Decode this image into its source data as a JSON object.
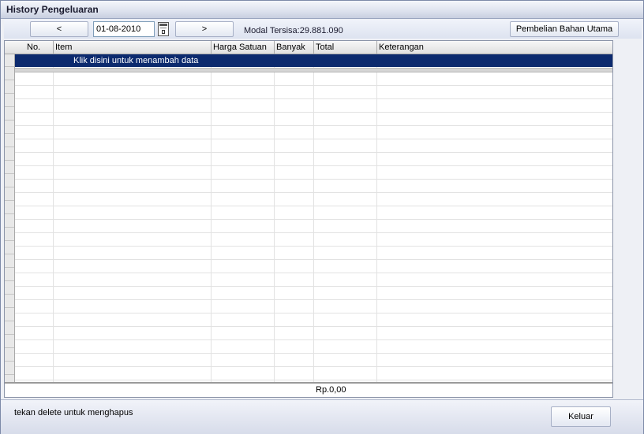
{
  "window": {
    "title": "History Pengeluaran"
  },
  "toolbar": {
    "prev_label": "<",
    "date_value": "01-08-2010",
    "calendar_icon": "calendar-icon",
    "next_label": ">",
    "modal_tersisa": "Modal Tersisa:29.881.090",
    "pembelian_label": "Pembelian Bahan Utama"
  },
  "grid": {
    "columns": [
      "No.",
      "Item",
      "Harga Satuan",
      "Banyak",
      "Total",
      "Keterangan"
    ],
    "new_row_text": "Klik disini untuk menambah data",
    "footer_total": "Rp.0,00"
  },
  "status": {
    "hint": "tekan delete untuk menghapus",
    "keluar_label": "Keluar"
  }
}
